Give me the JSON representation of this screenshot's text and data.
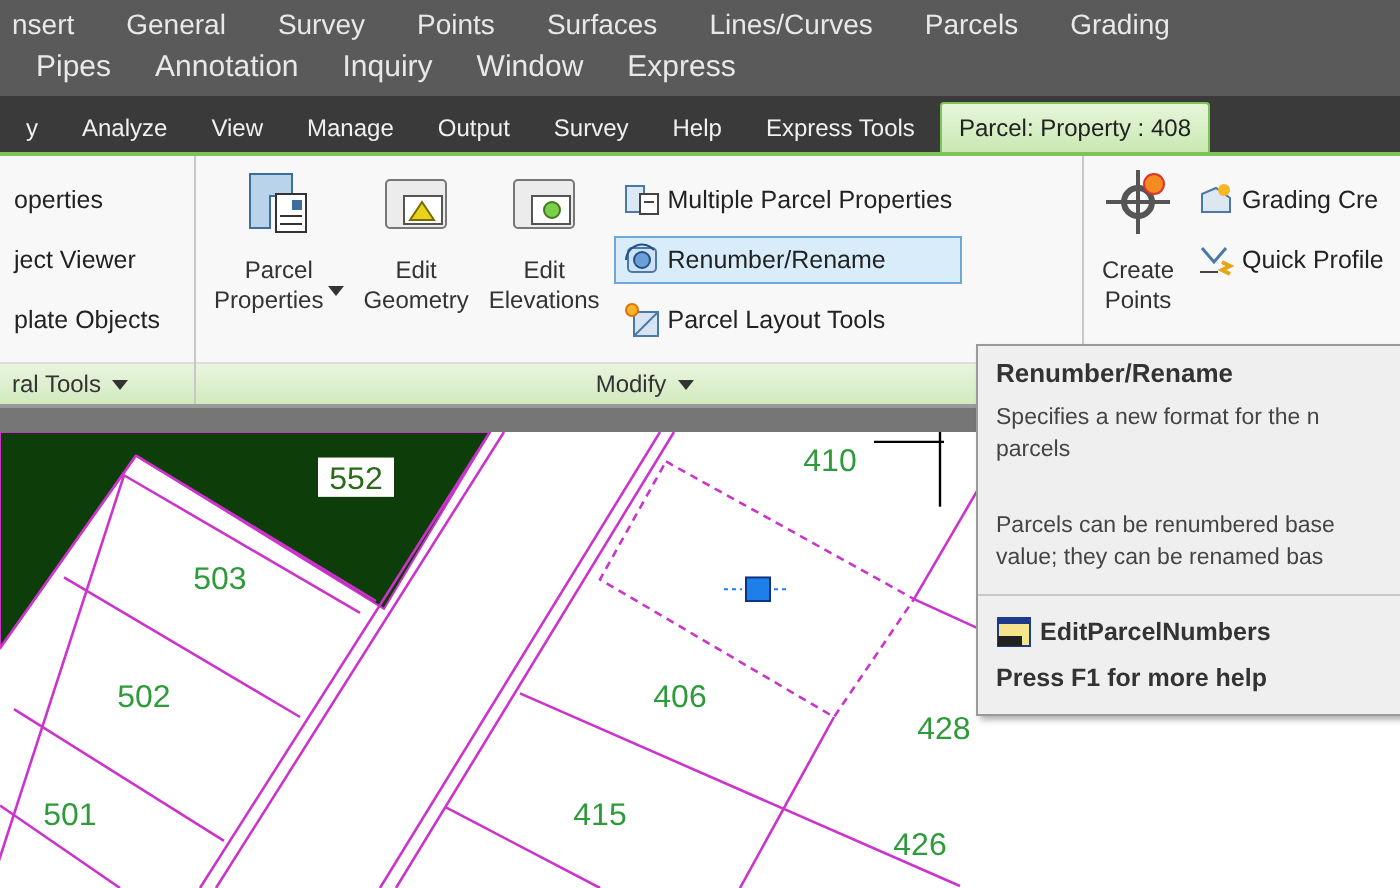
{
  "menu_rows": [
    [
      "nsert",
      "General",
      "Survey",
      "Points",
      "Surfaces",
      "Lines/Curves",
      "Parcels",
      "Grading"
    ],
    [
      "Pipes",
      "Annotation",
      "Inquiry",
      "Window",
      "Express"
    ]
  ],
  "ribbon_tabs": [
    {
      "label": "y",
      "selected": false
    },
    {
      "label": "Analyze",
      "selected": false
    },
    {
      "label": "View",
      "selected": false
    },
    {
      "label": "Manage",
      "selected": false
    },
    {
      "label": "Output",
      "selected": false
    },
    {
      "label": "Survey",
      "selected": false
    },
    {
      "label": "Help",
      "selected": false
    },
    {
      "label": "Express Tools",
      "selected": false
    },
    {
      "label": "Parcel: Property : 408",
      "selected": true
    }
  ],
  "panels": [
    {
      "title": "ral Tools",
      "items": [
        {
          "kind": "small",
          "label": "operties",
          "hovered": false
        },
        {
          "kind": "small",
          "label": "ject Viewer",
          "hovered": false
        },
        {
          "kind": "small",
          "label": "plate Objects",
          "hovered": false
        }
      ]
    },
    {
      "title": "Modify",
      "items": [
        {
          "kind": "large",
          "label": [
            "Parcel",
            "Properties"
          ],
          "dropdown": true
        },
        {
          "kind": "large",
          "label": [
            "Edit",
            "Geometry"
          ],
          "dropdown": false
        },
        {
          "kind": "large",
          "label": [
            "Edit",
            "Elevations"
          ],
          "dropdown": false
        },
        {
          "kind": "small",
          "label": "Multiple Parcel Properties",
          "hovered": false
        },
        {
          "kind": "small",
          "label": "Renumber/Rename",
          "hovered": true
        },
        {
          "kind": "small",
          "label": "Parcel Layout Tools",
          "hovered": false
        }
      ]
    },
    {
      "items": [
        {
          "kind": "large",
          "label": [
            "Create",
            "Points"
          ],
          "dropdown": false
        },
        {
          "kind": "small",
          "label": "Grading Cre",
          "hovered": false
        },
        {
          "kind": "small",
          "label": "Quick Profile",
          "hovered": false
        }
      ]
    }
  ],
  "map": {
    "parcels": [
      {
        "label": "552",
        "kind": "boxed"
      },
      {
        "label": "503",
        "kind": "plain"
      },
      {
        "label": "502",
        "kind": "plain"
      },
      {
        "label": "501",
        "kind": "plain"
      },
      {
        "label": "410",
        "kind": "plain"
      },
      {
        "label": "406",
        "kind": "plain"
      },
      {
        "label": "415",
        "kind": "plain"
      },
      {
        "label": "428",
        "kind": "plain"
      },
      {
        "label": "426",
        "kind": "plain"
      }
    ]
  },
  "tooltip": {
    "title": "Renumber/Rename",
    "paragraphs": [
      [
        "Specifies a new format for the n",
        "parcels"
      ],
      [
        "Parcels can be renumbered base",
        "value; they can be renamed bas"
      ]
    ],
    "command": "EditParcelNumbers",
    "help": "Press F1 for more help"
  }
}
